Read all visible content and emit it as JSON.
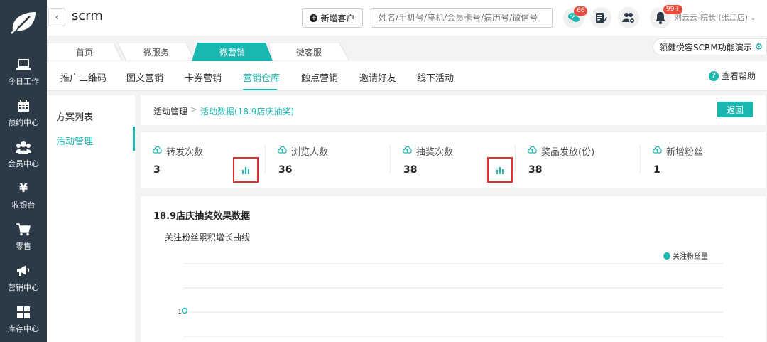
{
  "app": {
    "title": "scrm"
  },
  "colors": {
    "accent": "#1ab6b0",
    "sidebar": "#2b3a46",
    "highlight_border": "#e53030",
    "badge": "#e94b3c"
  },
  "sidebar": {
    "items": [
      {
        "label": "今日工作",
        "icon": "laptop-icon"
      },
      {
        "label": "预约中心",
        "icon": "calendar-icon"
      },
      {
        "label": "会员中心",
        "icon": "members-icon"
      },
      {
        "label": "收银台",
        "icon": "yen-icon"
      },
      {
        "label": "零售",
        "icon": "cart-icon"
      },
      {
        "label": "营销中心",
        "icon": "megaphone-icon"
      },
      {
        "label": "库存中心",
        "icon": "grid-icon"
      }
    ]
  },
  "header": {
    "add_customer": "新增客户",
    "search_placeholder": "姓名/手机号/座机/会员卡号/病历号/微信号",
    "wechat_badge": "66",
    "bell_badge": "99+",
    "user": "刘云云-院长 (张江店)"
  },
  "top_tabs": [
    {
      "label": "首页"
    },
    {
      "label": "微服务"
    },
    {
      "label": "微营销"
    },
    {
      "label": "微客服"
    }
  ],
  "demo_button": "领健悦容SCRM功能演示",
  "subnav": {
    "items": [
      "推广二维码",
      "图文营销",
      "卡券营销",
      "营销仓库",
      "触点营销",
      "邀请好友",
      "线下活动"
    ],
    "help": "查看帮助"
  },
  "submenu": {
    "items": [
      "方案列表",
      "活动管理"
    ]
  },
  "breadcrumb": {
    "root": "活动管理",
    "separator": ">",
    "current": "活动数据(18.9店庆抽奖)"
  },
  "return_button": "返回",
  "stats": [
    {
      "label": "转发次数",
      "value": "3"
    },
    {
      "label": "浏览人数",
      "value": "36"
    },
    {
      "label": "抽奖次数",
      "value": "38"
    },
    {
      "label": "奖品发放(份)",
      "value": "38"
    },
    {
      "label": "新增粉丝",
      "value": "1"
    }
  ],
  "panel": {
    "title": "18.9店庆抽奖效果数据"
  },
  "chart_data": {
    "type": "line",
    "title": "关注粉丝累积增长曲线",
    "series": [
      {
        "name": "关注粉丝量",
        "values": [
          1
        ]
      }
    ],
    "y_tick_labels": [
      "1"
    ],
    "grid": true,
    "legend": "top-right"
  }
}
